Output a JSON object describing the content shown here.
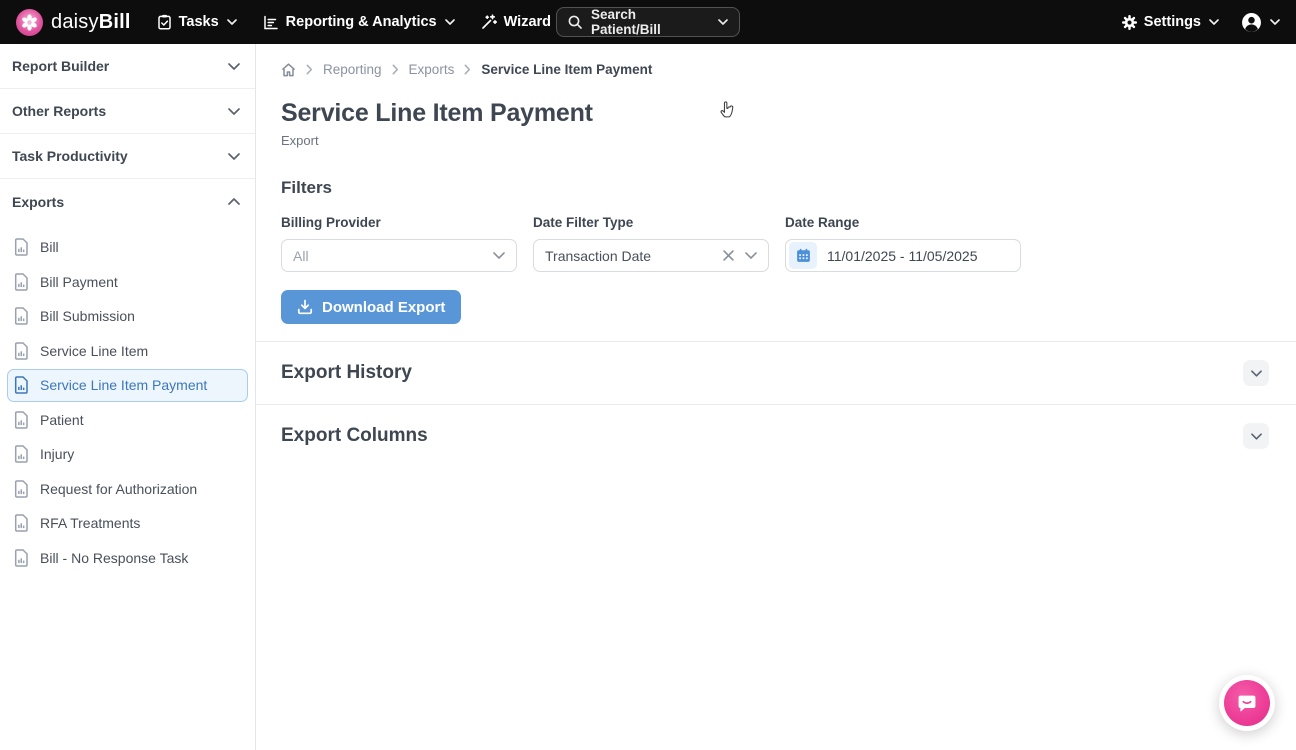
{
  "navbar": {
    "brand": {
      "text_light": "daisy",
      "text_bold": "Bill"
    },
    "menus": [
      {
        "label": "Tasks",
        "icon": "clipboard-tasks-icon"
      },
      {
        "label": "Reporting & Analytics",
        "icon": "bar-chart-icon"
      },
      {
        "label": "Wizard",
        "icon": "magic-wand-icon"
      }
    ],
    "search_label": "Search Patient/Bill",
    "settings_label": "Settings"
  },
  "sidebar": {
    "sections": [
      {
        "label": "Report Builder",
        "state": "collapsed"
      },
      {
        "label": "Other Reports",
        "state": "collapsed"
      },
      {
        "label": "Task Productivity",
        "state": "collapsed"
      },
      {
        "label": "Exports",
        "state": "expanded"
      }
    ],
    "export_items": [
      {
        "label": "Bill",
        "selected": false
      },
      {
        "label": "Bill Payment",
        "selected": false
      },
      {
        "label": "Bill Submission",
        "selected": false
      },
      {
        "label": "Service Line Item",
        "selected": false
      },
      {
        "label": "Service Line Item Payment",
        "selected": true
      },
      {
        "label": "Patient",
        "selected": false
      },
      {
        "label": "Injury",
        "selected": false
      },
      {
        "label": "Request for Authorization",
        "selected": false
      },
      {
        "label": "RFA Treatments",
        "selected": false
      },
      {
        "label": "Bill - No Response Task",
        "selected": false
      }
    ]
  },
  "breadcrumb": {
    "links": [
      "Reporting",
      "Exports"
    ],
    "current": "Service Line Item Payment"
  },
  "page": {
    "title": "Service Line Item Payment",
    "subtitle": "Export"
  },
  "filters": {
    "heading": "Filters",
    "billing_provider": {
      "label": "Billing Provider",
      "value": "All"
    },
    "date_filter_type": {
      "label": "Date Filter Type",
      "value": "Transaction Date"
    },
    "date_range": {
      "label": "Date Range",
      "value": "11/01/2025 - 11/05/2025"
    },
    "download_button": "Download Export"
  },
  "panels": [
    {
      "title": "Export History"
    },
    {
      "title": "Export Columns"
    }
  ],
  "colors": {
    "navbar_bg": "#0d0d0d",
    "brand_pink": "#e1549e",
    "accent_blue": "#5896d8",
    "selected_item_bg": "#eef6fd",
    "selected_item_border": "#a9cdec",
    "selected_item_text": "#3c77bd",
    "text_dark": "#3d4651",
    "text_muted": "#8a93a0",
    "divider": "#e9eaec",
    "date_icon_bg": "#e8f2fc",
    "intercom_pink": "#ed3c96"
  }
}
